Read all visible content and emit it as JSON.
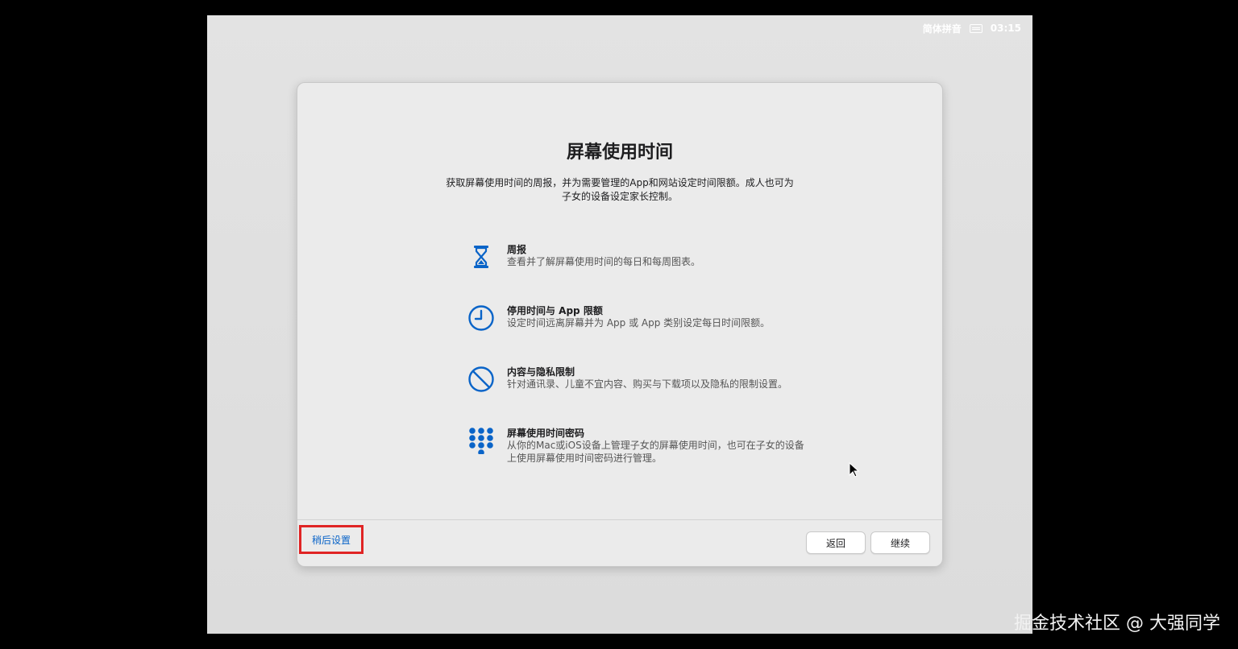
{
  "menubar": {
    "input_method": "简体拼音",
    "keyboard_icon": "keyboard-icon",
    "time": "03:15"
  },
  "page": {
    "title": "屏幕使用时间",
    "subtitle": "获取屏幕使用时间的周报，并为需要管理的App和网站设定时间限额。成人也可为子女的设备设定家长控制。"
  },
  "features": [
    {
      "icon": "hourglass-icon",
      "title": "周报",
      "description": "查看并了解屏幕使用时间的每日和每周图表。"
    },
    {
      "icon": "clock-icon",
      "title": "停用时间与 App 限额",
      "description": "设定时间远离屏幕并为 App 或 App 类别设定每日时间限额。"
    },
    {
      "icon": "prohibited-icon",
      "title": "内容与隐私限制",
      "description": "针对通讯录、儿童不宜内容、购买与下载项以及隐私的限制设置。"
    },
    {
      "icon": "keypad-icon",
      "title": "屏幕使用时间密码",
      "description": "从你的Mac或iOS设备上管理子女的屏幕使用时间，也可在子女的设备上使用屏幕使用时间密码进行管理。"
    }
  ],
  "footer": {
    "later_label": "稍后设置",
    "back_label": "返回",
    "continue_label": "继续"
  },
  "colors": {
    "accent": "#0a64c8",
    "highlight_box": "#e02424"
  },
  "watermark": "掘金技术社区 @ 大强同学"
}
